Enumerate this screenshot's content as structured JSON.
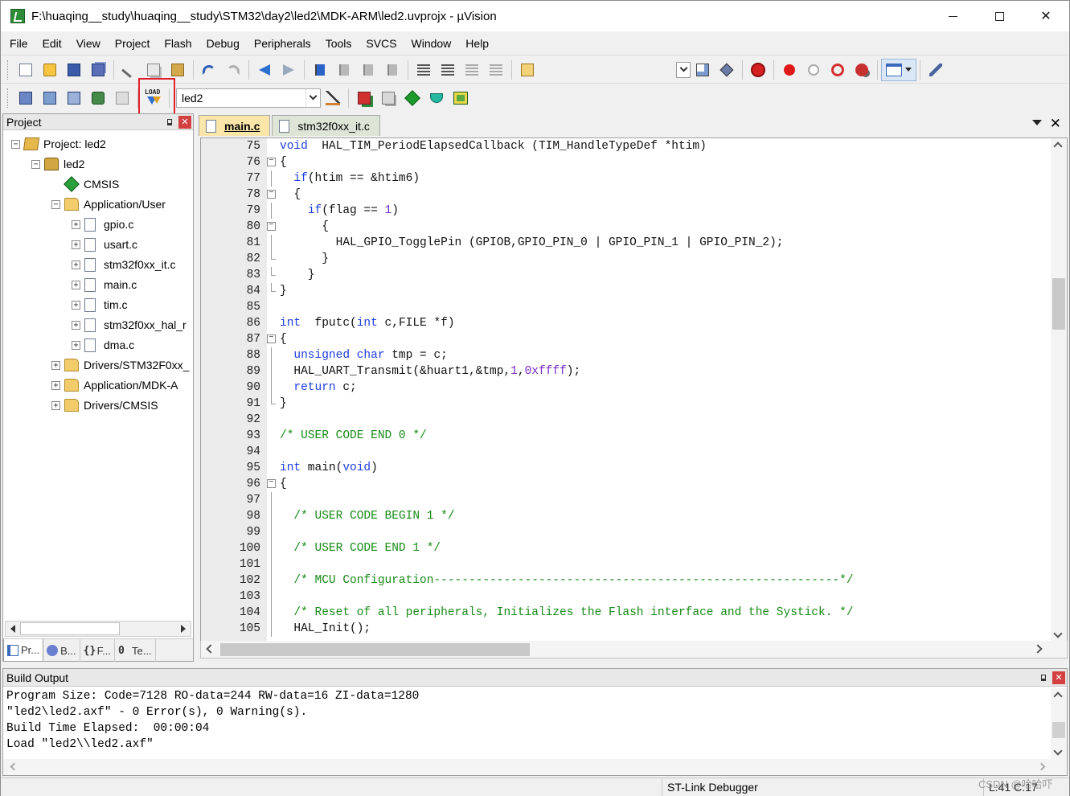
{
  "window": {
    "title": "F:\\huaqing__study\\huaqing__study\\STM32\\day2\\led2\\MDK-ARM\\led2.uvprojx - µVision"
  },
  "menu": [
    "File",
    "Edit",
    "View",
    "Project",
    "Flash",
    "Debug",
    "Peripherals",
    "Tools",
    "SVCS",
    "Window",
    "Help"
  ],
  "toolbar2": {
    "target": "led2",
    "load_icon_text": "LOAD"
  },
  "project_panel": {
    "title": "Project",
    "tree": [
      {
        "label": "Project: led2",
        "icon": "project-icon",
        "level": 0,
        "expander": "−"
      },
      {
        "label": "led2",
        "icon": "target-icon",
        "level": 1,
        "expander": "−"
      },
      {
        "label": "CMSIS",
        "icon": "cmsis-icon",
        "level": 2,
        "expander": ""
      },
      {
        "label": "Application/User",
        "icon": "folder-icon",
        "level": 2,
        "expander": "−"
      },
      {
        "label": "gpio.c",
        "icon": "file-icon",
        "level": 3,
        "expander": "+"
      },
      {
        "label": "usart.c",
        "icon": "file-icon",
        "level": 3,
        "expander": "+"
      },
      {
        "label": "stm32f0xx_it.c",
        "icon": "file-icon",
        "level": 3,
        "expander": "+"
      },
      {
        "label": "main.c",
        "icon": "file-icon",
        "level": 3,
        "expander": "+"
      },
      {
        "label": "tim.c",
        "icon": "file-icon",
        "level": 3,
        "expander": "+"
      },
      {
        "label": "stm32f0xx_hal_r",
        "icon": "file-icon",
        "level": 3,
        "expander": "+"
      },
      {
        "label": "dma.c",
        "icon": "file-icon",
        "level": 3,
        "expander": "+"
      },
      {
        "label": "Drivers/STM32F0xx_",
        "icon": "folder-icon",
        "level": 2,
        "expander": "+"
      },
      {
        "label": "Application/MDK-A",
        "icon": "folder-icon",
        "level": 2,
        "expander": "+"
      },
      {
        "label": "Drivers/CMSIS",
        "icon": "folder-icon",
        "level": 2,
        "expander": "+"
      }
    ],
    "tabs": [
      {
        "label": "Pr...",
        "icon": "project-tab-icon",
        "glyph": ""
      },
      {
        "label": "B...",
        "icon": "books-tab-icon",
        "glyph": ""
      },
      {
        "label": "F...",
        "icon": "functions-tab-icon",
        "glyph": "{}"
      },
      {
        "label": "Te...",
        "icon": "templates-tab-icon",
        "glyph": "0"
      }
    ]
  },
  "editor": {
    "tabs": [
      {
        "label": "main.c",
        "active": true
      },
      {
        "label": "stm32f0xx_it.c",
        "active": false
      }
    ],
    "lines": [
      {
        "n": "75",
        "fold": "",
        "tokens": [
          [
            "kw",
            "void"
          ],
          [
            "",
            "  HAL_TIM_PeriodElapsedCallback (TIM_HandleTypeDef *htim)"
          ]
        ]
      },
      {
        "n": "76",
        "fold": "box",
        "tokens": [
          [
            "",
            "{"
          ]
        ]
      },
      {
        "n": "77",
        "fold": "line",
        "tokens": [
          [
            "",
            "  "
          ],
          [
            "kw",
            "if"
          ],
          [
            "",
            "(htim == &htim6)"
          ]
        ]
      },
      {
        "n": "78",
        "fold": "box",
        "tokens": [
          [
            "",
            "  {"
          ]
        ]
      },
      {
        "n": "79",
        "fold": "line",
        "tokens": [
          [
            "",
            "    "
          ],
          [
            "kw",
            "if"
          ],
          [
            "",
            "(flag == "
          ],
          [
            "num",
            "1"
          ],
          [
            "",
            ")"
          ]
        ]
      },
      {
        "n": "80",
        "fold": "box",
        "tokens": [
          [
            "",
            "      {"
          ]
        ]
      },
      {
        "n": "81",
        "fold": "line",
        "tokens": [
          [
            "",
            "        HAL_GPIO_TogglePin (GPIOB,GPIO_PIN_0 | GPIO_PIN_1 | GPIO_PIN_2);"
          ]
        ]
      },
      {
        "n": "82",
        "fold": "end",
        "tokens": [
          [
            "",
            "      }"
          ]
        ]
      },
      {
        "n": "83",
        "fold": "end",
        "tokens": [
          [
            "",
            "    }"
          ]
        ]
      },
      {
        "n": "84",
        "fold": "end",
        "tokens": [
          [
            "",
            "}"
          ]
        ]
      },
      {
        "n": "85",
        "fold": "",
        "tokens": [
          [
            "",
            ""
          ]
        ]
      },
      {
        "n": "86",
        "fold": "",
        "tokens": [
          [
            "kw",
            "int"
          ],
          [
            "",
            "  fputc("
          ],
          [
            "kw",
            "int"
          ],
          [
            "",
            " c,FILE *f)"
          ]
        ]
      },
      {
        "n": "87",
        "fold": "box",
        "tokens": [
          [
            "",
            "{"
          ]
        ]
      },
      {
        "n": "88",
        "fold": "line",
        "tokens": [
          [
            "",
            "  "
          ],
          [
            "kw",
            "unsigned char"
          ],
          [
            "",
            " tmp = c;"
          ]
        ]
      },
      {
        "n": "89",
        "fold": "line",
        "tokens": [
          [
            "",
            "  HAL_UART_Transmit(&huart1,&tmp,"
          ],
          [
            "num",
            "1"
          ],
          [
            "",
            ","
          ],
          [
            "num",
            "0xffff"
          ],
          [
            "",
            ");"
          ]
        ]
      },
      {
        "n": "90",
        "fold": "line",
        "tokens": [
          [
            "",
            "  "
          ],
          [
            "kw",
            "return"
          ],
          [
            "",
            " c;"
          ]
        ]
      },
      {
        "n": "91",
        "fold": "end",
        "tokens": [
          [
            "",
            "}"
          ]
        ]
      },
      {
        "n": "92",
        "fold": "",
        "tokens": [
          [
            "",
            ""
          ]
        ]
      },
      {
        "n": "93",
        "fold": "",
        "tokens": [
          [
            "cm",
            "/* USER CODE END 0 */"
          ]
        ]
      },
      {
        "n": "94",
        "fold": "",
        "tokens": [
          [
            "",
            ""
          ]
        ]
      },
      {
        "n": "95",
        "fold": "",
        "tokens": [
          [
            "kw",
            "int"
          ],
          [
            "",
            " main("
          ],
          [
            "kw",
            "void"
          ],
          [
            "",
            ")"
          ]
        ]
      },
      {
        "n": "96",
        "fold": "box",
        "tokens": [
          [
            "",
            "{"
          ]
        ]
      },
      {
        "n": "97",
        "fold": "line",
        "tokens": [
          [
            "",
            ""
          ]
        ]
      },
      {
        "n": "98",
        "fold": "line",
        "tokens": [
          [
            "",
            "  "
          ],
          [
            "cm",
            "/* USER CODE BEGIN 1 */"
          ]
        ]
      },
      {
        "n": "99",
        "fold": "line",
        "tokens": [
          [
            "",
            ""
          ]
        ]
      },
      {
        "n": "100",
        "fold": "line",
        "tokens": [
          [
            "",
            "  "
          ],
          [
            "cm",
            "/* USER CODE END 1 */"
          ]
        ]
      },
      {
        "n": "101",
        "fold": "line",
        "tokens": [
          [
            "",
            ""
          ]
        ]
      },
      {
        "n": "102",
        "fold": "line",
        "tokens": [
          [
            "",
            "  "
          ],
          [
            "cm",
            "/* MCU Configuration----------------------------------------------------------*/"
          ]
        ]
      },
      {
        "n": "103",
        "fold": "line",
        "tokens": [
          [
            "",
            ""
          ]
        ]
      },
      {
        "n": "104",
        "fold": "line",
        "tokens": [
          [
            "",
            "  "
          ],
          [
            "cm",
            "/* Reset of all peripherals, Initializes the Flash interface and the Systick. */"
          ]
        ]
      },
      {
        "n": "105",
        "fold": "line",
        "tokens": [
          [
            "",
            "  HAL_Init();"
          ]
        ]
      }
    ]
  },
  "build_output": {
    "title": "Build Output",
    "lines": [
      "Program Size: Code=7128 RO-data=244 RW-data=16 ZI-data=1280",
      "\"led2\\led2.axf\" - 0 Error(s), 0 Warning(s).",
      "Build Time Elapsed:  00:00:04",
      "Load \"led2\\\\led2.axf\""
    ]
  },
  "statusbar": {
    "debugger": "ST-Link Debugger",
    "position": "L:41 C:17"
  },
  "watermark": "CSDN @哈哈吓"
}
